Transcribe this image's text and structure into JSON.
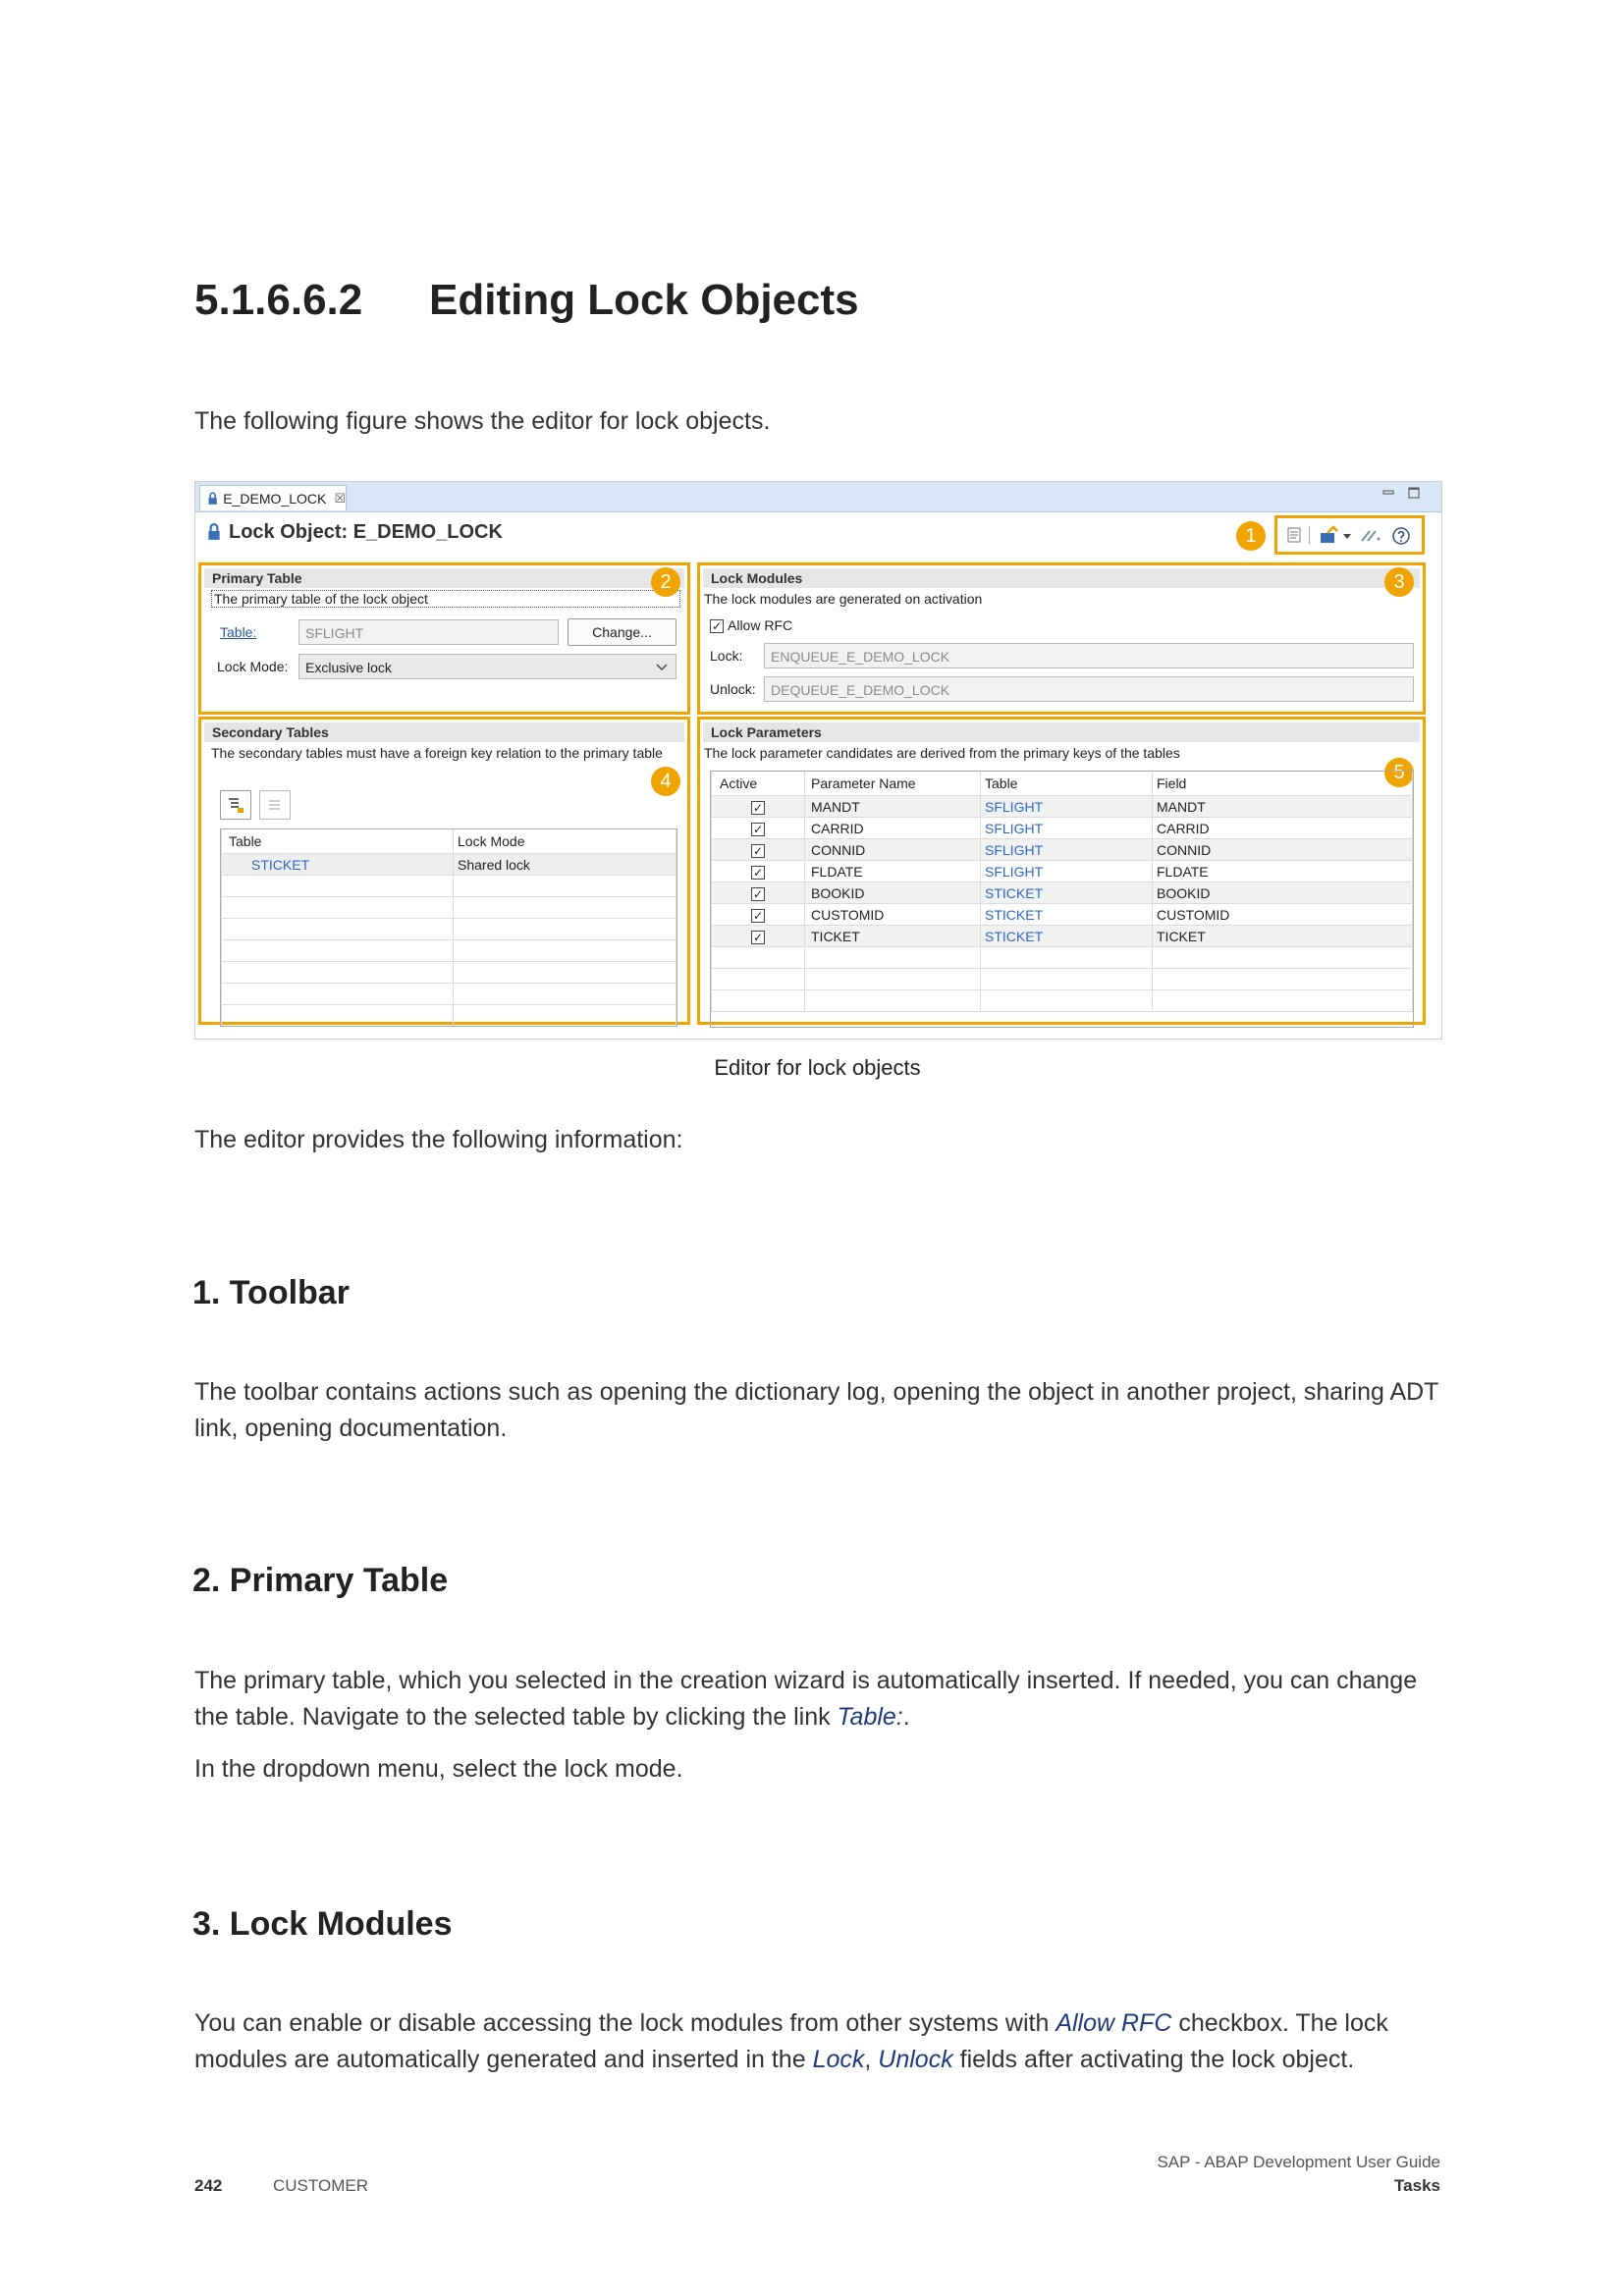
{
  "section": {
    "number": "5.1.6.6.2",
    "title": "Editing Lock Objects"
  },
  "intro": "The following figure shows the editor for lock objects.",
  "figure": {
    "tab_label": "E_DEMO_LOCK",
    "tab_close": "☒",
    "header_title": "Lock Object: E_DEMO_LOCK",
    "markers": [
      "1",
      "2",
      "3",
      "4",
      "5"
    ],
    "primary_table": {
      "heading": "Primary Table",
      "description": "The primary table of the lock object",
      "table_link": "Table:",
      "table_value": "SFLIGHT",
      "change_button": "Change...",
      "lock_mode_label": "Lock Mode:",
      "lock_mode_value": "Exclusive lock"
    },
    "lock_modules": {
      "heading": "Lock Modules",
      "description": "The lock modules are generated on activation",
      "allow_rfc_label": "Allow RFC",
      "allow_rfc_checked": true,
      "lock_label": "Lock:",
      "lock_value": "ENQUEUE_E_DEMO_LOCK",
      "unlock_label": "Unlock:",
      "unlock_value": "DEQUEUE_E_DEMO_LOCK"
    },
    "secondary_tables": {
      "heading": "Secondary Tables",
      "description": "The secondary tables must have a foreign key relation to the primary table",
      "columns": [
        "Table",
        "Lock Mode"
      ],
      "rows": [
        {
          "table": "STICKET",
          "lock_mode": "Shared lock"
        }
      ]
    },
    "lock_parameters": {
      "heading": "Lock Parameters",
      "description": "The lock parameter candidates are derived from the primary keys of the tables",
      "columns": [
        "Active",
        "Parameter Name",
        "Table",
        "Field"
      ],
      "rows": [
        {
          "active": true,
          "name": "MANDT",
          "table": "SFLIGHT",
          "field": "MANDT"
        },
        {
          "active": true,
          "name": "CARRID",
          "table": "SFLIGHT",
          "field": "CARRID"
        },
        {
          "active": true,
          "name": "CONNID",
          "table": "SFLIGHT",
          "field": "CONNID"
        },
        {
          "active": true,
          "name": "FLDATE",
          "table": "SFLIGHT",
          "field": "FLDATE"
        },
        {
          "active": true,
          "name": "BOOKID",
          "table": "STICKET",
          "field": "BOOKID"
        },
        {
          "active": true,
          "name": "CUSTOMID",
          "table": "STICKET",
          "field": "CUSTOMID"
        },
        {
          "active": true,
          "name": "TICKET",
          "table": "STICKET",
          "field": "TICKET"
        }
      ]
    },
    "caption": "Editor for lock objects",
    "accent_color": "#f0a400"
  },
  "editor_info": "The editor provides the following information:",
  "toolbar_section": {
    "heading": "1. Toolbar",
    "text": "The toolbar contains actions such as opening the dictionary log, opening the object in another project, sharing ADT link, opening documentation."
  },
  "primary_section": {
    "heading": "2. Primary Table",
    "text_before": "The primary table, which you selected in the creation wizard is automatically inserted. If needed, you can change the table. Navigate to the selected table by clicking the link ",
    "link": "Table:",
    "text_after": ".",
    "text2": "In the dropdown menu, select the lock mode."
  },
  "modules_section": {
    "heading": "3. Lock Modules",
    "text_1": "You can enable or disable accessing the lock modules from other systems with ",
    "allow_rfc": "Allow RFC",
    "text_2": " checkbox. The lock modules are automatically generated and inserted in the ",
    "lock": "Lock",
    "sep": ", ",
    "unlock": "Unlock",
    "text_3": " fields after activating the lock object."
  },
  "footer": {
    "page_number": "242",
    "classification": "CUSTOMER",
    "guide_title": "SAP - ABAP Development User Guide",
    "chapter": "Tasks"
  }
}
